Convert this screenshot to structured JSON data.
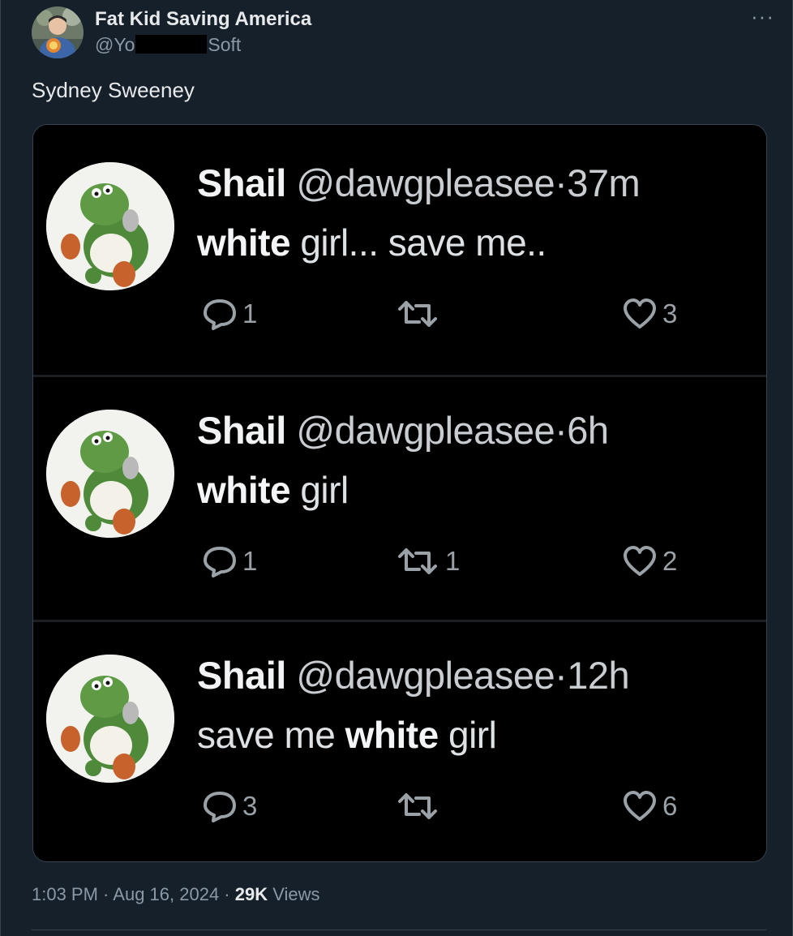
{
  "post": {
    "author_name": "Fat Kid Saving America",
    "handle_start": "@Yo",
    "handle_end": "Soft",
    "more_label": "···",
    "text": "Sydney Sweeney",
    "time": "1:03 PM",
    "date": "Aug 16, 2024",
    "views_count": "29K",
    "views_label": "Views",
    "separator": " · "
  },
  "screenshot_tweets": [
    {
      "name": "Shail",
      "handle": "@dawgpleasee",
      "time": "37m",
      "text_bold_1": "white",
      "text_rest": " girl... save me..",
      "text_pre": "",
      "replies": "1",
      "retweets": "",
      "likes": "3"
    },
    {
      "name": "Shail",
      "handle": "@dawgpleasee",
      "time": "6h",
      "text_pre": "",
      "text_bold_1": "white",
      "text_rest": " girl",
      "replies": "1",
      "retweets": "1",
      "likes": "2"
    },
    {
      "name": "Shail",
      "handle": "@dawgpleasee",
      "time": "12h",
      "text_pre": "save me ",
      "text_bold_1": "white",
      "text_rest": " girl",
      "replies": "3",
      "retweets": "",
      "likes": "6"
    }
  ],
  "colors": {
    "background": "#15202b",
    "media_background": "#000000",
    "secondary_text": "#8b98a5",
    "primary_text": "#e7e9ea"
  },
  "icons": [
    "more-icon",
    "reply-icon",
    "retweet-icon",
    "like-icon",
    "avatar",
    "yoshi-avatar"
  ]
}
